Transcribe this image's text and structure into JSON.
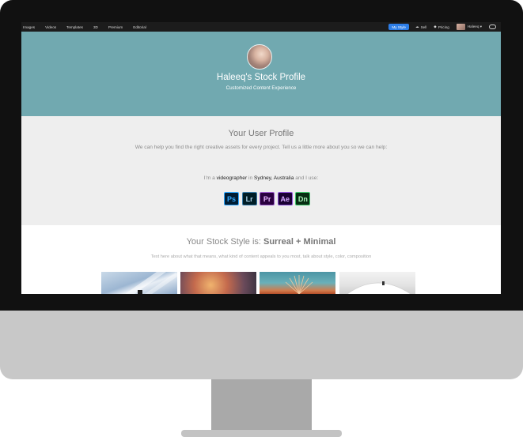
{
  "nav": {
    "links": [
      "Images",
      "Videos",
      "Templates",
      "3D",
      "Premium",
      "Editorial"
    ],
    "my_style": "My Style",
    "sell": "Sell",
    "pricing": "Pricing",
    "user": "Haleeq ▾"
  },
  "hero": {
    "title": "Haleeq's Stock Profile",
    "subtitle": "Customized Content Experience",
    "background": "#71a9b0"
  },
  "profile": {
    "title": "Your User Profile",
    "description": "We can help you find the right creative assets for every project. Tell us a little more about you so we can help:",
    "line_prefix": "I'm a ",
    "role": "videographer",
    "line_mid": " in ",
    "location": "Sydney, Australia",
    "line_suffix": " and I use:",
    "apps": [
      {
        "label": "Ps",
        "bg": "#001d34",
        "fg": "#31a8ff",
        "border": "#31a8ff"
      },
      {
        "label": "Lr",
        "bg": "#001d26",
        "fg": "#add5ec",
        "border": "#3a7aa6"
      },
      {
        "label": "Pr",
        "bg": "#2a003f",
        "fg": "#e6b3ff",
        "border": "#9b5acb"
      },
      {
        "label": "Ae",
        "bg": "#1a0033",
        "fg": "#d4a8ff",
        "border": "#8c4fd8"
      },
      {
        "label": "Dn",
        "bg": "#062e12",
        "fg": "#a8f0b8",
        "border": "#3fc46a"
      }
    ]
  },
  "style": {
    "title_prefix": "Your Stock Style is: ",
    "title_value": "Surreal + Minimal",
    "description": "Text here about what that means, what kind of content appeals to you most, talk about style, color, composition"
  }
}
